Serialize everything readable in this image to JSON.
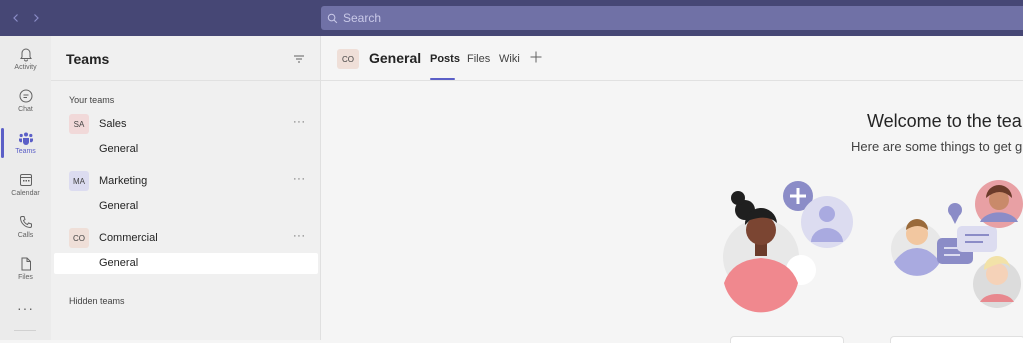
{
  "titlebar": {
    "back_icon": "chevron-left-icon",
    "forward_icon": "chevron-right-icon",
    "search_placeholder": "Search",
    "background": "#464775"
  },
  "rail": {
    "items": [
      {
        "label": "Activity",
        "icon": "bell-icon"
      },
      {
        "label": "Chat",
        "icon": "chat-icon"
      },
      {
        "label": "Teams",
        "icon": "teams-icon",
        "active": true
      },
      {
        "label": "Calendar",
        "icon": "calendar-icon"
      },
      {
        "label": "Calls",
        "icon": "phone-icon"
      },
      {
        "label": "Files",
        "icon": "file-icon"
      }
    ],
    "more": "···"
  },
  "panel": {
    "title": "Teams",
    "your_teams_label": "Your teams",
    "hidden_teams_label": "Hidden teams",
    "teams": [
      {
        "initials": "SA",
        "name": "Sales",
        "color": "#f1d9d9",
        "channels": [
          "General"
        ],
        "more": "···"
      },
      {
        "initials": "MA",
        "name": "Marketing",
        "color": "#dcdcf0",
        "channels": [
          "General"
        ],
        "more": "···"
      },
      {
        "initials": "CO",
        "name": "Commercial",
        "color": "#efdfd8",
        "channels": [
          "General"
        ],
        "more": "···",
        "selected_channel": "General"
      }
    ]
  },
  "main": {
    "channel_initials": "CO",
    "channel_title": "General",
    "tabs": [
      {
        "label": "Posts",
        "active": true
      },
      {
        "label": "Files"
      },
      {
        "label": "Wiki"
      }
    ],
    "welcome_title": "Welcome to the tea",
    "welcome_subtitle": "Here are some things to get g"
  },
  "colors": {
    "accent": "#5b5fc7"
  }
}
